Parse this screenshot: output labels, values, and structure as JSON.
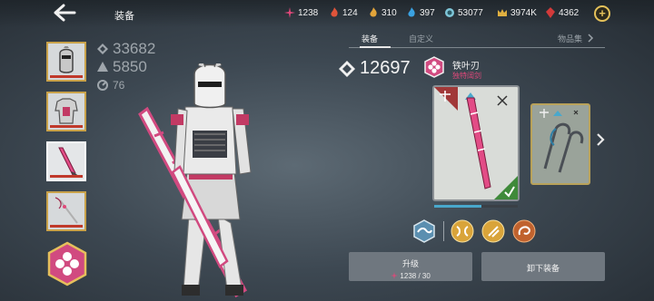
{
  "header": {
    "title": "装备",
    "back_icon": "back-arrow-icon",
    "resources": [
      {
        "name": "crimson-shard",
        "icon": "shard-icon",
        "value": "1238",
        "color": "#e0487a"
      },
      {
        "name": "red-flame",
        "icon": "flame-icon",
        "value": "124",
        "color": "#e0543a"
      },
      {
        "name": "gold-flame",
        "icon": "flame-icon",
        "value": "310",
        "color": "#e2a43a"
      },
      {
        "name": "blue-flame",
        "icon": "flame-icon",
        "value": "397",
        "color": "#3aa2e2"
      },
      {
        "name": "coins",
        "icon": "coin-icon",
        "value": "53077",
        "color": "#7ec6d8"
      },
      {
        "name": "gold",
        "icon": "crown-icon",
        "value": "3974K",
        "color": "#e0b040"
      },
      {
        "name": "gems",
        "icon": "gem-icon",
        "value": "4362",
        "color": "#d23a3a"
      }
    ]
  },
  "stats": {
    "power": "33682",
    "armor": "5850",
    "speed": "76"
  },
  "tabs": [
    "装备",
    "自定义",
    "物品集"
  ],
  "weapon": {
    "power": "12697",
    "name": "铁叶刃",
    "subtitle": "独特阔剑"
  },
  "buttons": {
    "upgrade_label": "升级",
    "upgrade_cost": "1238 / 30",
    "unequip_label": "卸下装备"
  },
  "colors": {
    "accent_pink": "#e0487a",
    "slot_border": "#c9a24a",
    "button_bg": "#6f777f"
  }
}
